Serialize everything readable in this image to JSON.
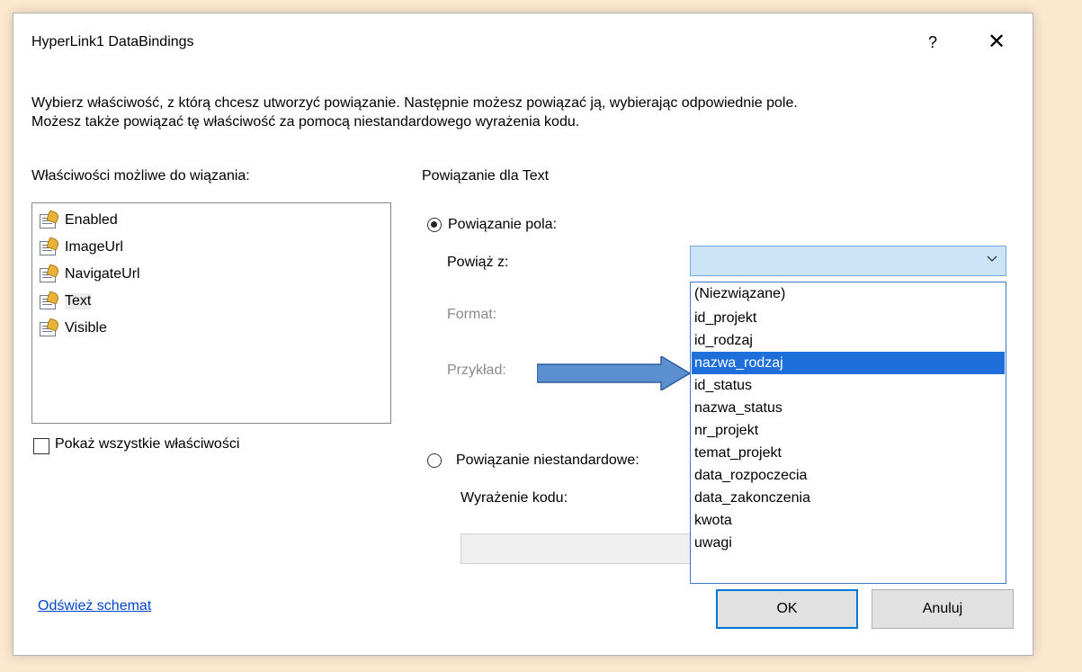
{
  "window": {
    "title": "HyperLink1 DataBindings",
    "help": "?",
    "close": "✕"
  },
  "description": {
    "line1": "Wybierz właściwość, z którą chcesz utworzyć powiązanie. Następnie możesz powiązać ją, wybierając odpowiednie pole.",
    "line2": "Możesz także powiązać tę właściwość za pomocą niestandardowego wyrażenia kodu."
  },
  "properties": {
    "label": "Właściwości możliwe do wiązania:",
    "items": [
      {
        "label": "Enabled"
      },
      {
        "label": "ImageUrl"
      },
      {
        "label": "NavigateUrl"
      },
      {
        "label": "Text",
        "selected": true
      },
      {
        "label": "Visible"
      }
    ],
    "show_all_label": "Pokaż wszystkie właściwości"
  },
  "binding": {
    "header": "Powiązanie dla Text",
    "field_binding_label": "Powiązanie pola:",
    "bind_to_label": "Powiąż z:",
    "bind_to_value": "",
    "format_label": "Format:",
    "example_label": "Przykład:",
    "custom_binding_label": "Powiązanie niestandardowe:",
    "code_expression_label": "Wyrażenie kodu:",
    "code_expression_value": ""
  },
  "dropdown": {
    "options": [
      "(Niezwiązane)",
      "id_projekt",
      "id_rodzaj",
      "nazwa_rodzaj",
      "id_status",
      "nazwa_status",
      "nr_projekt",
      "temat_projekt",
      "data_rozpoczecia",
      "data_zakonczenia",
      "kwota",
      "uwagi"
    ],
    "highlighted": "nazwa_rodzaj"
  },
  "footer": {
    "refresh_link": "Odśwież schemat",
    "ok": "OK",
    "cancel": "Anuluj"
  },
  "colors": {
    "highlight": "#1e6fd9",
    "arrow": "#4f81bd",
    "background": "#fbe8cf"
  }
}
